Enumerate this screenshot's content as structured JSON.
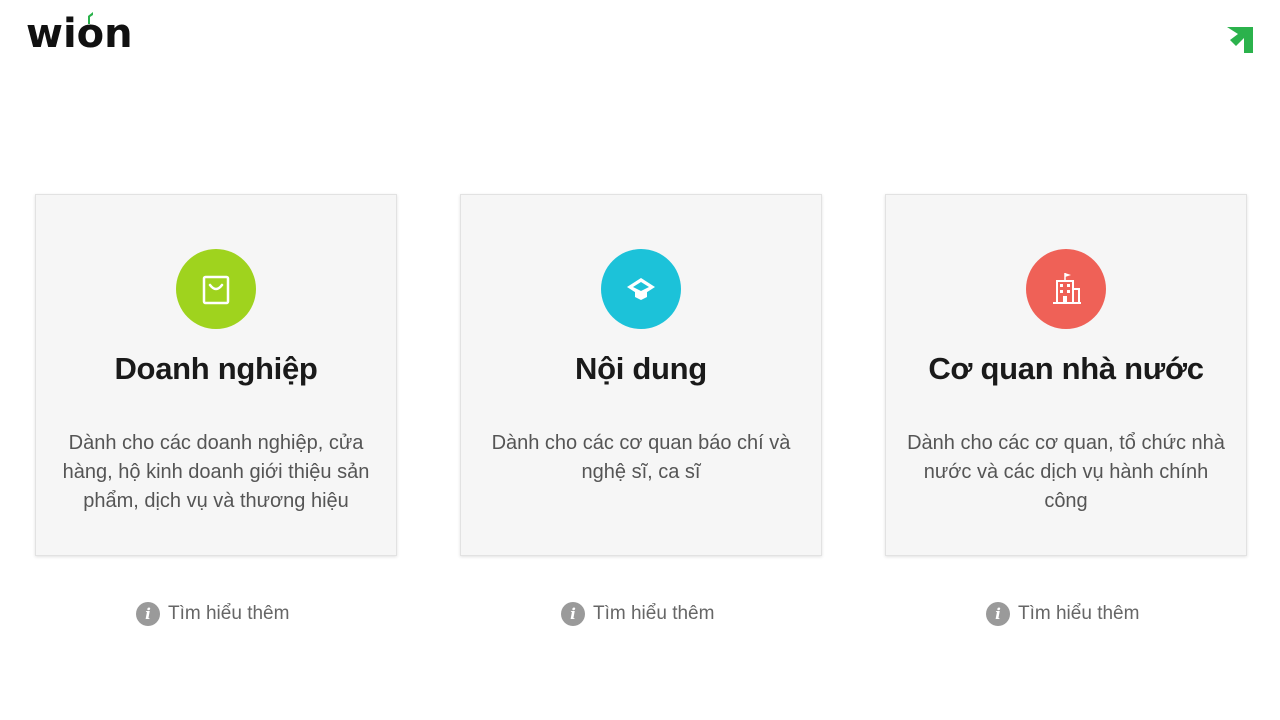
{
  "brand": {
    "logo_text": "wion",
    "accent_color": "#2bb24c"
  },
  "cards": [
    {
      "title": "Doanh nghiệp",
      "description": "Dành cho các doanh nghiệp, cửa hàng, hộ kinh doanh giới thiệu sản phẩm, dịch vụ và thương hiệu",
      "icon": "shopping-bag-icon",
      "icon_color": "#9fd31e",
      "learn_more": "Tìm hiểu thêm"
    },
    {
      "title": "Nội dung",
      "description": "Dành cho các cơ quan báo chí và nghệ sĩ, ca sĩ",
      "icon": "chat-bubble-icon",
      "icon_color": "#1cc2d9",
      "learn_more": "Tìm hiểu thêm"
    },
    {
      "title": "Cơ quan nhà nước",
      "description": "Dành cho các cơ quan, tổ chức nhà nước và các dịch vụ hành chính công",
      "icon": "building-icon",
      "icon_color": "#ef6157",
      "learn_more": "Tìm hiểu thêm"
    }
  ]
}
